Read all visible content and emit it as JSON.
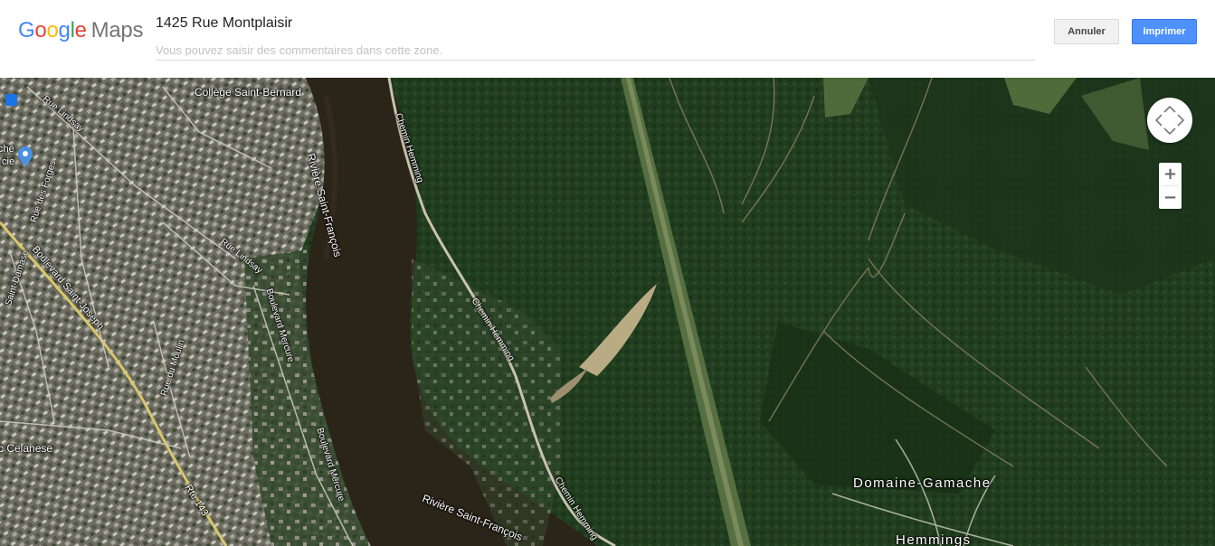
{
  "header": {
    "logo_google": "Google",
    "logo_maps": "Maps",
    "address": "1425 Rue Montplaisir",
    "comment_placeholder": "Vous pouvez saisir des commentaires dans cette zone.",
    "comment_value": "",
    "cancel_label": "Annuler",
    "print_label": "Imprimer"
  },
  "map": {
    "type": "satellite",
    "labels": {
      "college": "Collège Saint-Bernard",
      "river_north": "Rivière Saint-François",
      "river_south": "Rivière Saint-François",
      "chemin_north": "Chemin Hemming",
      "chemin_mid": "Chemin Hemming",
      "chemin_south": "Chemin Hemming",
      "rue_lindsay_nw": "Rue Lindsay",
      "rue_lindsay_mid": "Rue Lindsay",
      "rue_des_forges": "Rue des Forges",
      "saint_damase": "Saint-Damase",
      "boulevard_saint_joseph": "Boulevard Saint-Joseph",
      "rue_du_moulin": "Rue du Moulin",
      "boulevard_mercure_n": "Boulevard Mercure",
      "boulevard_mercure_s": "Boulevard Mercure",
      "route_143": "Rte 143",
      "celanese": "c Celanese",
      "domaine_gamache": "Domaine-Gamache",
      "hemmings": "Hemmings",
      "poi_partial_1": "ché",
      "poi_partial_2": "cie"
    },
    "controls": {
      "zoom_in": "+",
      "zoom_out": "−"
    },
    "colors": {
      "forest": "#1f3a1e",
      "river": "#2a2116",
      "urban": "#7d7d72",
      "accent": "#4285f4"
    }
  }
}
